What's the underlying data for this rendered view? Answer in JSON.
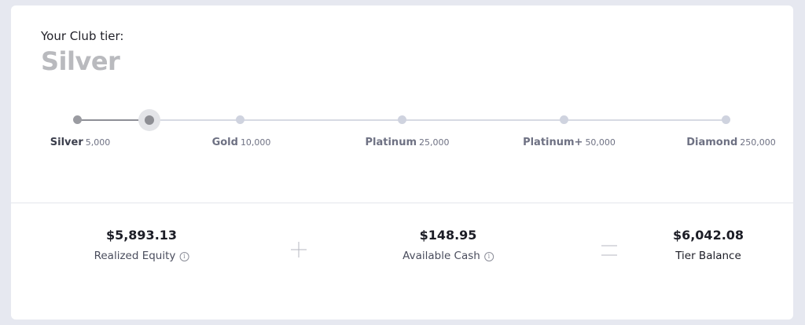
{
  "header": {
    "tier_label": "Your Club tier:",
    "tier_name": "Silver"
  },
  "progress": {
    "current_points": 5893.13,
    "milestones": [
      {
        "name": "Silver",
        "points": "5,000",
        "reached": true
      },
      {
        "name": "Gold",
        "points": "10,000",
        "reached": false
      },
      {
        "name": "Platinum",
        "points": "25,000",
        "reached": false
      },
      {
        "name": "Platinum+",
        "points": "50,000",
        "reached": false
      },
      {
        "name": "Diamond",
        "points": "250,000",
        "reached": false
      }
    ]
  },
  "summary": {
    "realized_equity": {
      "value": "$5,893.13",
      "label": "Realized Equity",
      "info_icon": "info-icon"
    },
    "plus_operator": "plus-icon",
    "available_cash": {
      "value": "$148.95",
      "label": "Available Cash",
      "info_icon": "info-icon"
    },
    "equals_operator": "equals-icon",
    "tier_balance": {
      "value": "$6,042.08",
      "label": "Tier Balance"
    }
  },
  "colors": {
    "page_bg": "#e6e8f0",
    "card_bg": "#ffffff",
    "tier_name": "#b9babe",
    "track": "#d7dae3",
    "track_reached": "#8e8f96"
  }
}
